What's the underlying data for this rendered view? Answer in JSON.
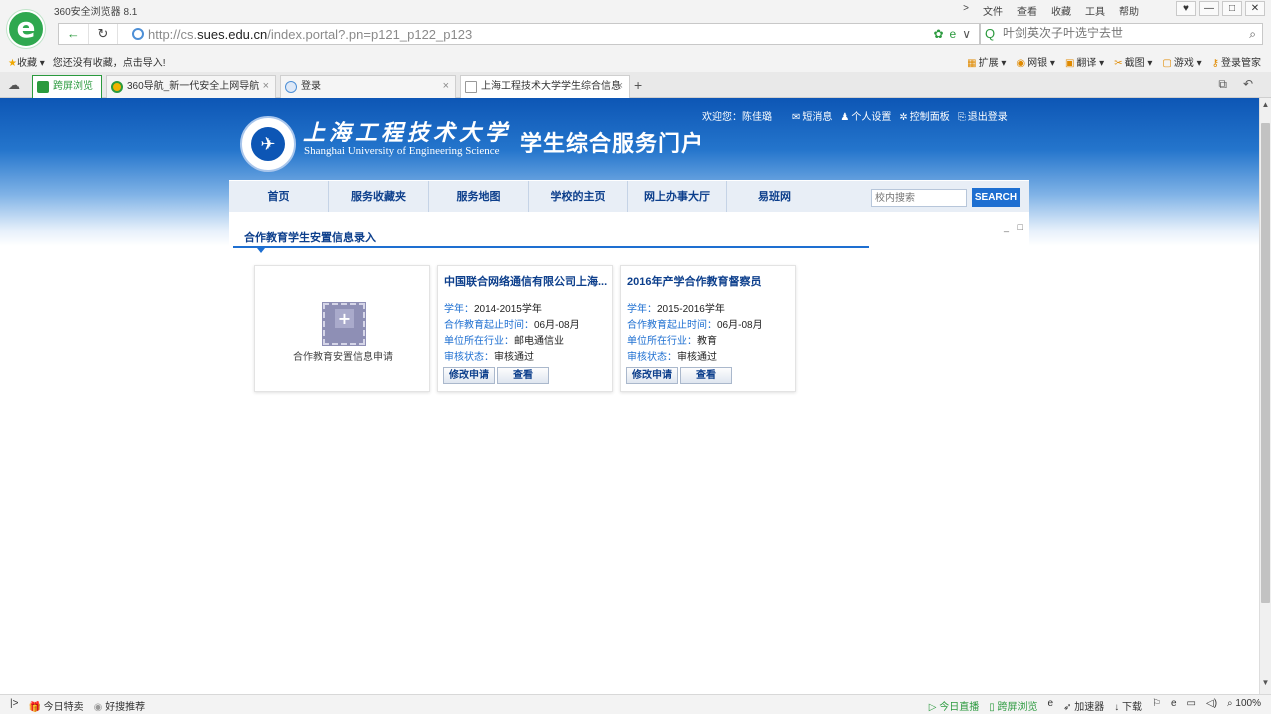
{
  "browser": {
    "app_title": "360安全浏览器 8.1",
    "menu": [
      "文件",
      "查看",
      "收藏",
      "工具",
      "帮助"
    ],
    "window_controls": [
      "♥",
      "—",
      "□",
      "✕"
    ],
    "url": {
      "prefix": "http://cs.",
      "domain": "sues.edu.cn",
      "suffix": "/index.portal?.pn=p121_p122_p123"
    },
    "search_placeholder": "叶剑英次子叶选宁去世",
    "favorites_label": "收藏",
    "favorites_hint": "您还没有收藏，点击导入!",
    "toolbar_right": [
      "扩展",
      "网银",
      "翻译",
      "截图",
      "游戏",
      "登录管家"
    ],
    "tabs": [
      {
        "label": "跨屏浏览"
      },
      {
        "label": "360导航_新一代安全上网导航"
      },
      {
        "label": "登录"
      },
      {
        "label": "上海工程技术大学学生综合信息"
      }
    ]
  },
  "header": {
    "university_cn": "上海工程技术大学",
    "university_en": "Shanghai University of Engineering Science",
    "portal_title": "学生综合服务门户",
    "welcome": "欢迎您：陈佳璐",
    "user_links": [
      "短消息",
      "个人设置",
      "控制面板",
      "退出登录"
    ]
  },
  "nav": {
    "items": [
      "首页",
      "服务收藏夹",
      "服务地图",
      "学校的主页",
      "网上办事大厅",
      "易班网"
    ],
    "search_placeholder": "校内搜索",
    "search_button": "SEARCH"
  },
  "section": {
    "title": "合作教育学生安置信息录入",
    "window_controls": "_ □"
  },
  "add_card": {
    "label": "合作教育安置信息申请"
  },
  "labels": {
    "year": "学年：",
    "period": "合作教育起止时间：",
    "industry": "单位所在行业：",
    "status": "审核状态："
  },
  "records": [
    {
      "title": "中国联合网络通信有限公司上海...",
      "year": "2014-2015学年",
      "period": "06月-08月",
      "industry": "邮电通信业",
      "status": "审核通过",
      "edit_button": "修改申请",
      "view_button": "查看"
    },
    {
      "title": "2016年产学合作教育督察员",
      "year": "2015-2016学年",
      "period": "06月-08月",
      "industry": "教育",
      "status": "审核通过",
      "edit_button": "修改申请",
      "view_button": "查看"
    }
  ],
  "statusbar": {
    "left": [
      "今日特卖",
      "好搜推荐"
    ],
    "right": [
      "今日直播",
      "跨屏浏览",
      "加速器",
      "下载"
    ],
    "zoom": "100%"
  }
}
